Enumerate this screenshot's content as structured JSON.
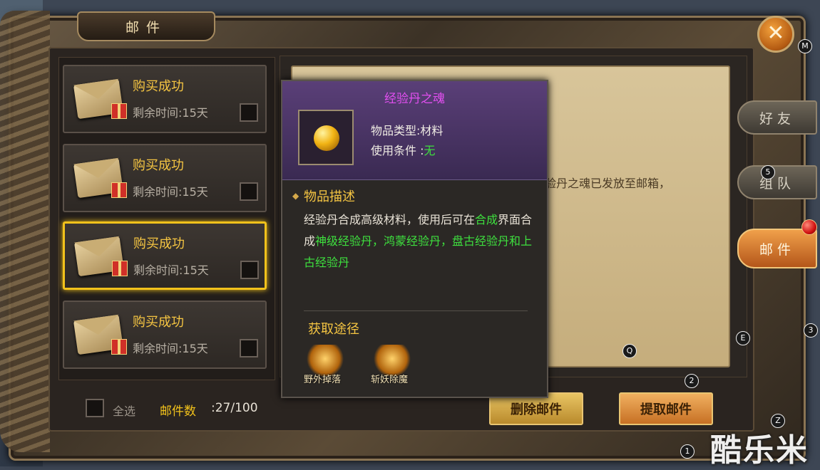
{
  "window": {
    "title": "邮件",
    "close_icon": "close-icon"
  },
  "mails": [
    {
      "title": "购买成功",
      "time": "剩余时间:15天",
      "selected": false
    },
    {
      "title": "购买成功",
      "time": "剩余时间:15天",
      "selected": false
    },
    {
      "title": "购买成功",
      "time": "剩余时间:15天",
      "selected": true
    },
    {
      "title": "购买成功",
      "time": "剩余时间:15天",
      "selected": false
    }
  ],
  "footer": {
    "select_all": "全选",
    "count_label": "邮件数",
    "count_value": ":27/100"
  },
  "detail": {
    "partial_text": "验丹之魂已发放至邮箱，"
  },
  "buttons": {
    "delete": "删除邮件",
    "claim": "提取邮件"
  },
  "tabs": [
    {
      "label": "好友",
      "active": false
    },
    {
      "label": "组队",
      "active": false
    },
    {
      "label": "邮件",
      "active": true
    }
  ],
  "tooltip": {
    "name": "经验丹之魂",
    "type_label": "物品类型",
    "type_value": ":材料",
    "cond_label": "使用条件",
    "cond_value": "无",
    "desc_title": "物品描述",
    "desc_1": "经验丹合成高级材料，使用后可在",
    "desc_2": "合成",
    "desc_3": "界面合成",
    "desc_4": "神级经验丹，鸿蒙经验丹，盘古经验丹和上古经验丹",
    "source_title": "获取途径",
    "sources": [
      "野外掉落",
      "斩妖除魔"
    ]
  },
  "badges": [
    "M",
    "5",
    "Q",
    "E",
    "3",
    "2",
    "Z",
    "1"
  ],
  "watermark": "酷乐米",
  "colors": {
    "gold": "#f5c542",
    "green": "#3ee03e",
    "purple": "#e24ff0",
    "selected_border": "#f2c21b"
  }
}
